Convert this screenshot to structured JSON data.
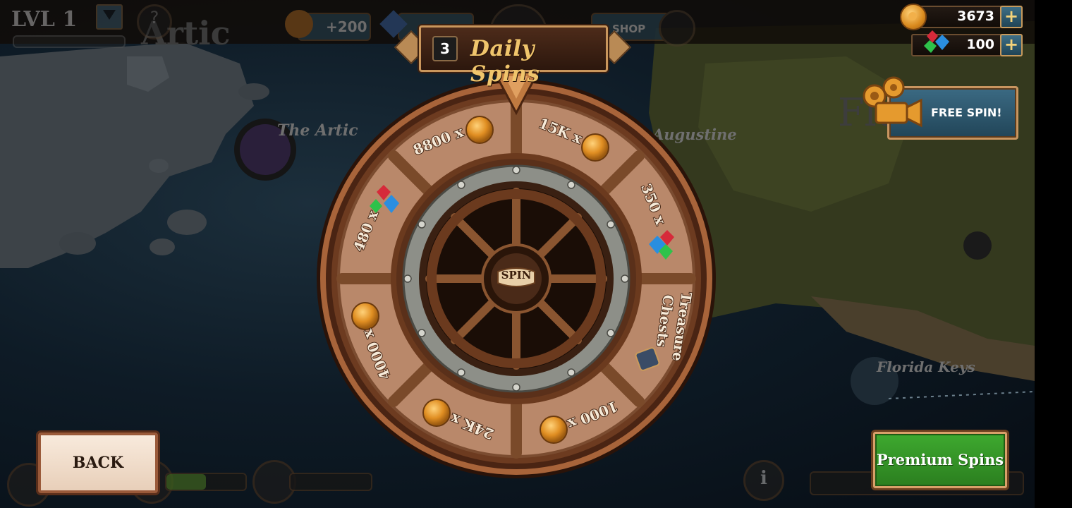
{
  "hud": {
    "level_label": "LVL 1",
    "reward_pill_label": "+200",
    "shop_label": "SHOP",
    "coins_value": "3673",
    "gems_value": "100",
    "plus_symbol": "+"
  },
  "map": {
    "region_artic_large": "Artic",
    "region_artic": "The Artic",
    "region_augustine": "Augustine",
    "region_florida_large": "Flo",
    "region_florida_keys": "Florida Keys"
  },
  "banner": {
    "spins_count": "3",
    "title": "Daily Spins"
  },
  "wheel": {
    "center_label": "SPIN",
    "rewards": [
      "8800 x",
      "15K x",
      "350 x",
      "Treasure",
      "Chests",
      "1000 x",
      "24K x",
      "4000 x",
      "480 x"
    ]
  },
  "buttons": {
    "free_spin": "FREE SPIN!",
    "back": "BACK",
    "premium": "Premium Spins"
  },
  "colors": {
    "banner_gold": "#f0c56c",
    "premium_green": "#2f8f24",
    "wood": "#8b5a34"
  }
}
